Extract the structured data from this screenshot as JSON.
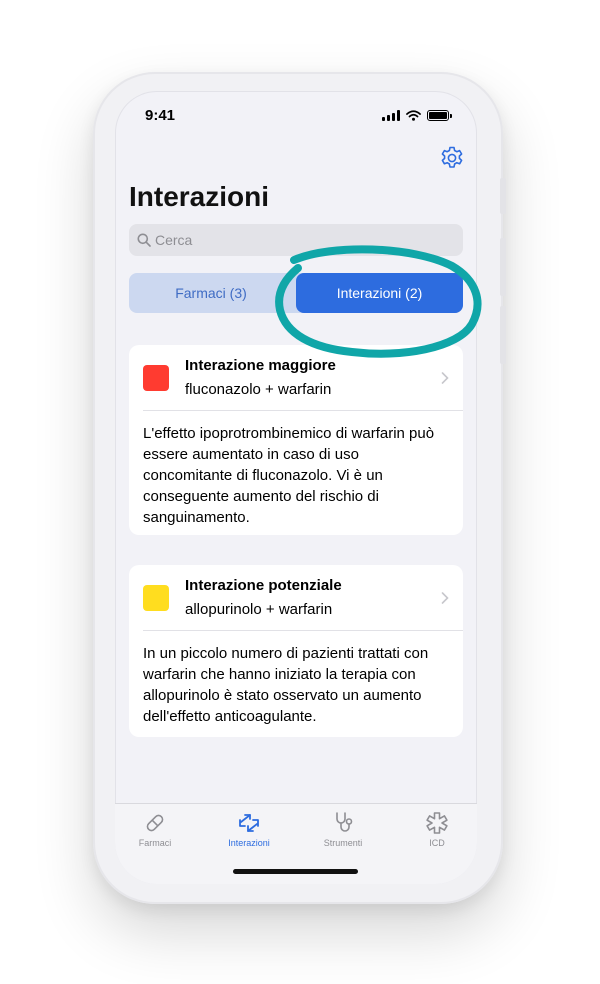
{
  "status_bar": {
    "time": "9:41"
  },
  "header": {
    "title": "Interazioni"
  },
  "search": {
    "placeholder": "Cerca"
  },
  "segments": {
    "farmaci": "Farmaci (3)",
    "interazioni": "Interazioni (2)"
  },
  "interactions": [
    {
      "severity_color": "#ff3b30",
      "title": "Interazione maggiore",
      "drugs": "fluconazolo + warfarin",
      "description": "L'effetto ipoprotrombinemico di warfarin può essere aumentato in caso di uso concomitante di fluconazolo. Vi è un conseguente aumento del rischio di sanguinamento."
    },
    {
      "severity_color": "#ffdd1f",
      "title": "Interazione potenziale",
      "drugs": "allopurinolo + warfarin",
      "description": "In un piccolo numero di pazienti trattati con warfarin che hanno iniziato la terapia con allopurinolo è stato osservato un aumento dell'effetto anticoagulante."
    }
  ],
  "tabbar": {
    "items": [
      {
        "label": "Farmaci",
        "icon": "pill-icon"
      },
      {
        "label": "Interazioni",
        "icon": "interactions-arrows-icon",
        "active": true
      },
      {
        "label": "Strumenti",
        "icon": "stethoscope-icon"
      },
      {
        "label": "ICD",
        "icon": "medical-symbol-icon"
      }
    ]
  },
  "colors": {
    "accent": "#2d6cdf",
    "segment_bg": "#ccd8f0",
    "highlight_ring": "#10a6a8"
  }
}
